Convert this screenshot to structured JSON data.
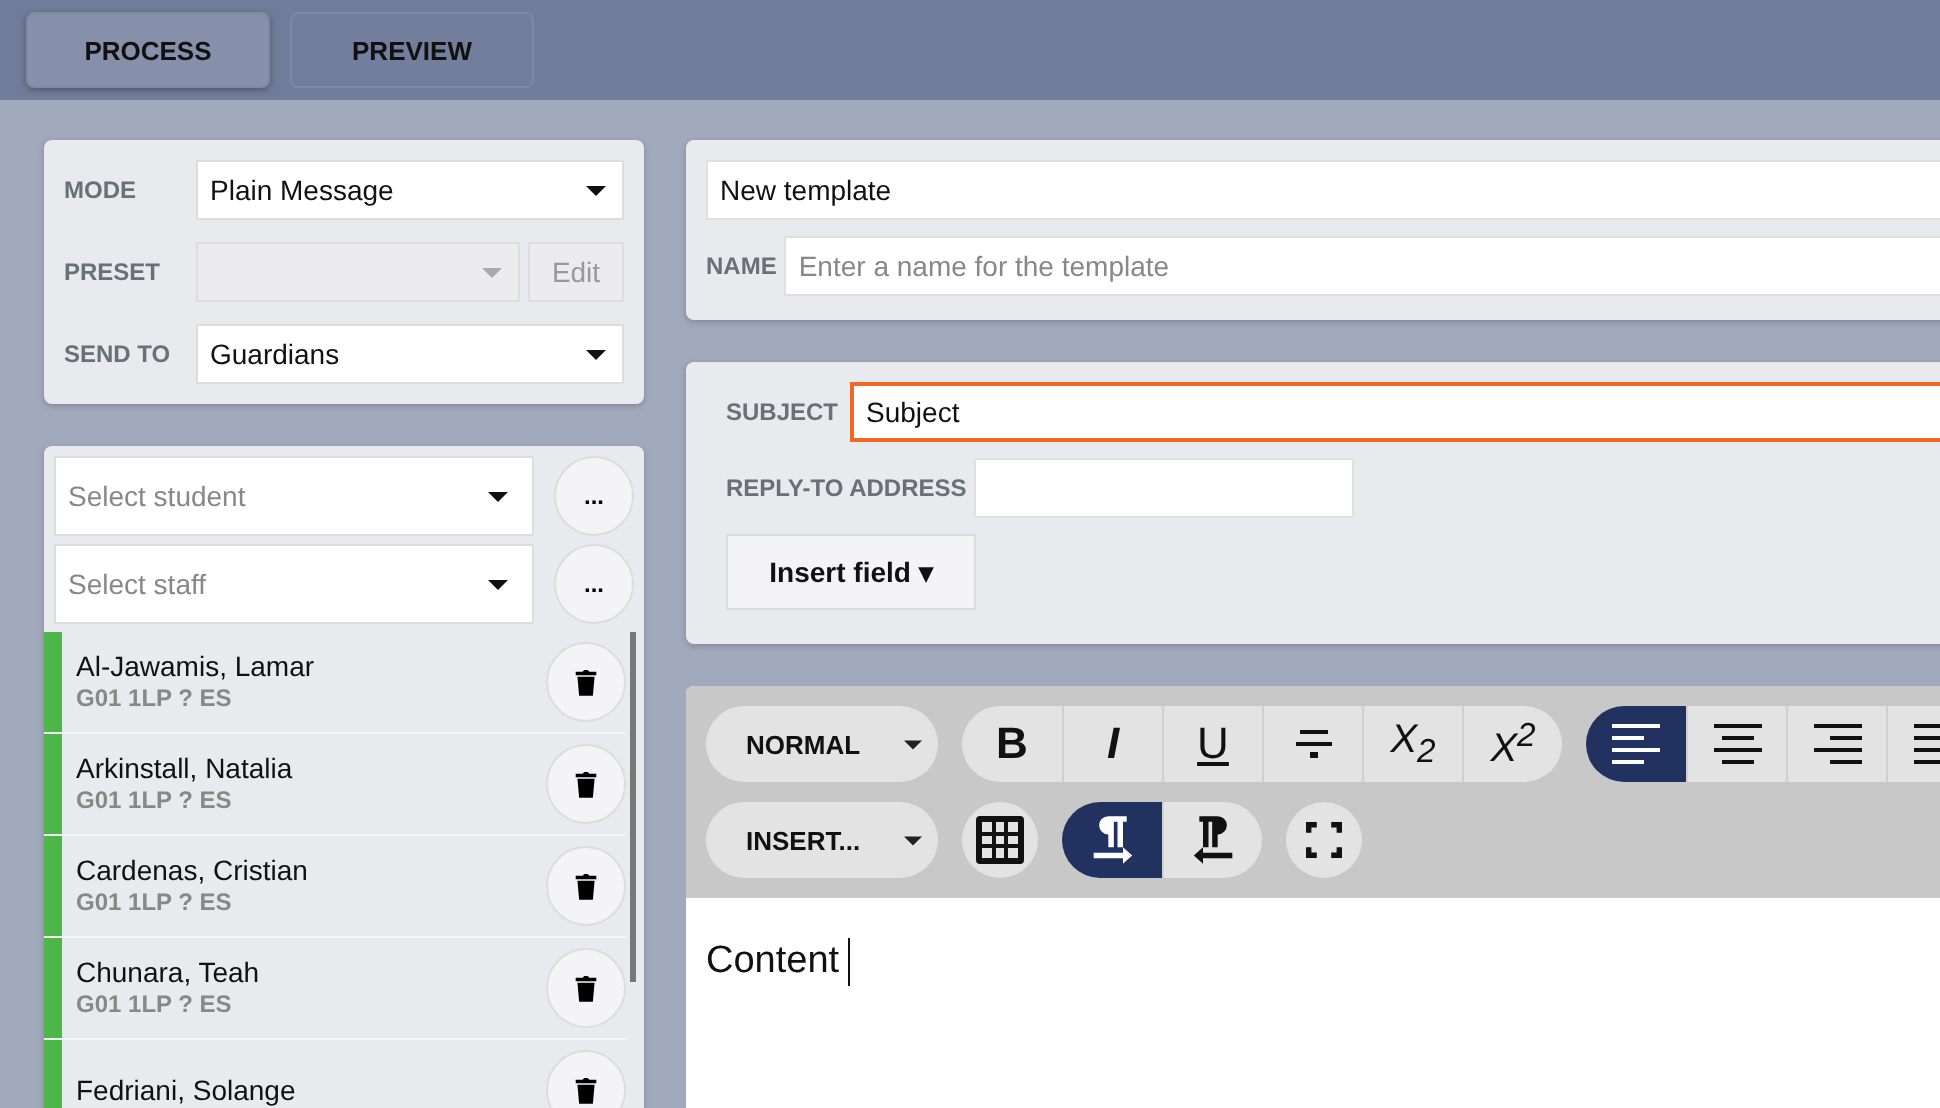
{
  "tabs": [
    {
      "label": "PROCESS",
      "selected": true
    },
    {
      "label": "PREVIEW",
      "selected": false
    }
  ],
  "settings": {
    "mode": {
      "label": "MODE",
      "value": "Plain Message"
    },
    "preset": {
      "label": "PRESET",
      "disabled": true,
      "edit_button": "Edit"
    },
    "send_to": {
      "label": "SEND TO",
      "value": "Guardians"
    }
  },
  "recipients": {
    "student_select": {
      "placeholder": "Select student",
      "more": "..."
    },
    "staff_select": {
      "placeholder": "Select staff",
      "more": "..."
    },
    "items": [
      {
        "name": "Al-Jawamis, Lamar",
        "group": "G01 1LP ? ES",
        "color": "#4cb648"
      },
      {
        "name": "Arkinstall, Natalia",
        "group": "G01 1LP ? ES",
        "color": "#4cb648"
      },
      {
        "name": "Cardenas, Cristian",
        "group": "G01 1LP ? ES",
        "color": "#4cb648"
      },
      {
        "name": "Chunara, Teah",
        "group": "G01 1LP ? ES",
        "color": "#4cb648"
      },
      {
        "name": "Fedriani, Solange",
        "color": "#4cb648"
      }
    ]
  },
  "template": {
    "title": "New template",
    "name_label": "NAME",
    "name_placeholder": "Enter a name for the template"
  },
  "message": {
    "subject_label": "SUBJECT",
    "subject": "Subject",
    "reply_label": "REPLY-TO ADDRESS",
    "insert_field": "Insert field ▾"
  },
  "editor": {
    "style_menu": "NORMAL",
    "insert_menu": "INSERT...",
    "format_buttons": [
      {
        "kind": "bold",
        "label": "B"
      },
      {
        "kind": "italic",
        "label": "I"
      },
      {
        "kind": "underline",
        "label": "U"
      },
      {
        "kind": "strike"
      },
      {
        "kind": "subscript",
        "label": "X$_{2}$"
      },
      {
        "kind": "superscript",
        "label": "X$^{2}$"
      }
    ],
    "align_buttons": [
      {
        "kind": "left",
        "selected": true
      },
      {
        "kind": "center",
        "selected": false
      },
      {
        "kind": "right",
        "selected": false
      },
      {
        "kind": "justify",
        "selected": false
      }
    ],
    "direction_buttons": [
      {
        "kind": "ltr",
        "selected": true
      },
      {
        "kind": "rtl",
        "selected": false
      }
    ],
    "content": "Content"
  }
}
